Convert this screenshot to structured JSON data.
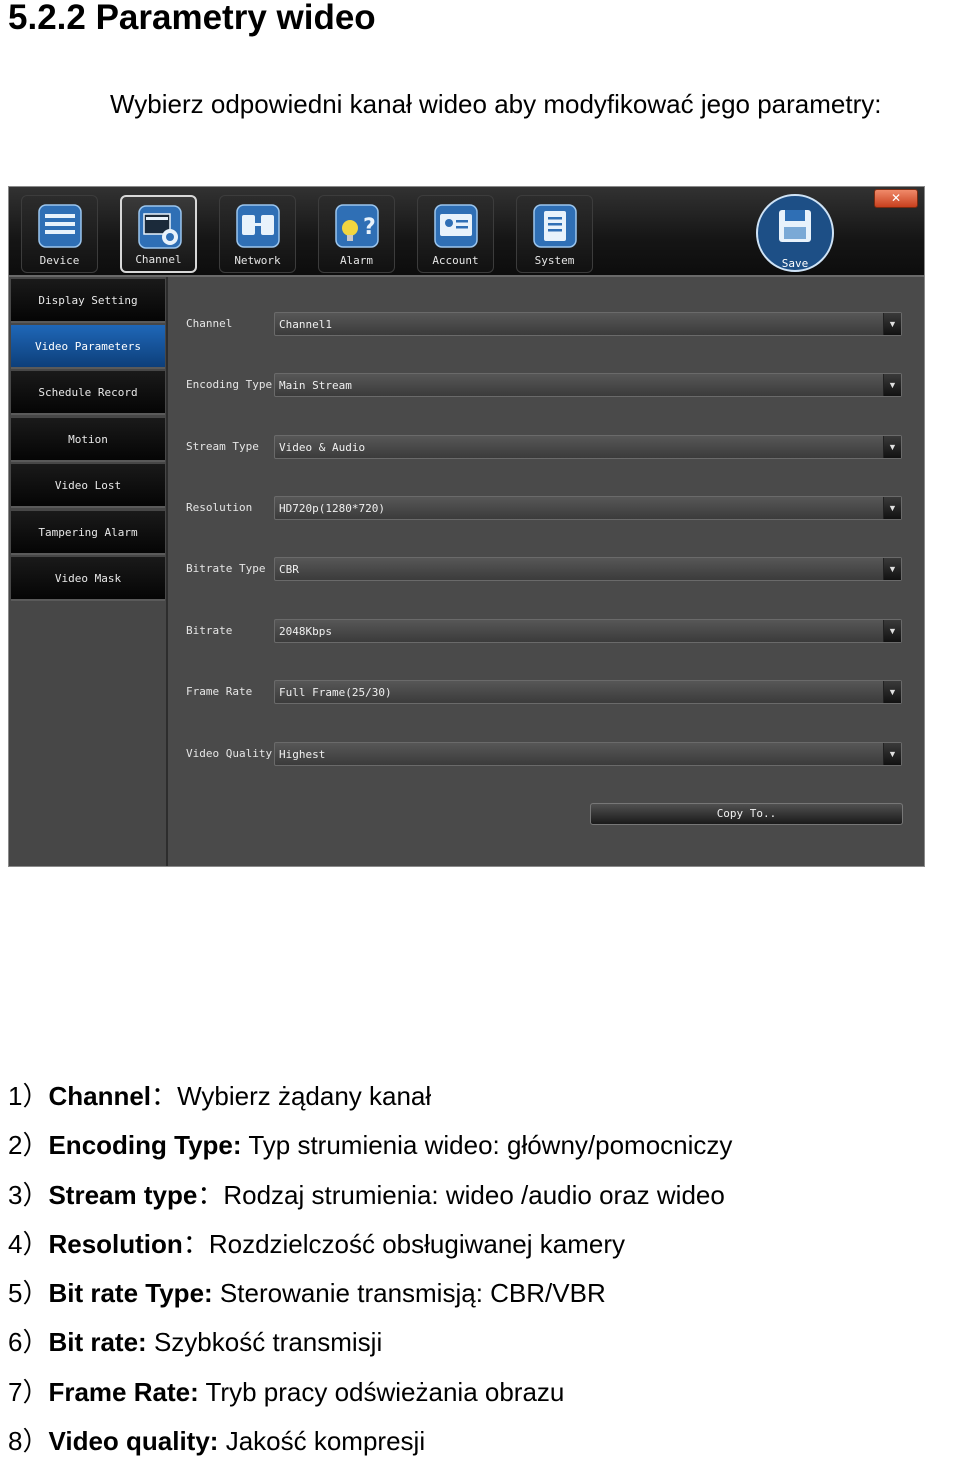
{
  "heading": "5.2.2 Parametry wideo",
  "intro": "Wybierz odpowiedni kanał wideo aby modyfikować jego parametry:",
  "window": {
    "close_glyph": "✕",
    "tabs": [
      {
        "label": "Device",
        "icon": "device-icon"
      },
      {
        "label": "Channel",
        "icon": "channel-icon"
      },
      {
        "label": "Network",
        "icon": "network-icon"
      },
      {
        "label": "Alarm",
        "icon": "alarm-icon"
      },
      {
        "label": "Account",
        "icon": "account-icon"
      },
      {
        "label": "System",
        "icon": "system-icon"
      }
    ],
    "active_tab": "Channel",
    "save_label": "Save",
    "sidebar": [
      "Display Setting",
      "Video Parameters",
      "Schedule Record",
      "Motion",
      "Video Lost",
      "Tampering Alarm",
      "Video Mask"
    ],
    "active_sidebar": "Video Parameters",
    "fields": [
      {
        "label": "Channel",
        "value": "Channel1"
      },
      {
        "label": "Encoding Type",
        "value": "Main Stream"
      },
      {
        "label": "Stream Type",
        "value": "Video & Audio"
      },
      {
        "label": "Resolution",
        "value": "HD720p(1280*720)"
      },
      {
        "label": "Bitrate Type",
        "value": "CBR"
      },
      {
        "label": "Bitrate",
        "value": "2048Kbps"
      },
      {
        "label": "Frame Rate",
        "value": "Full Frame(25/30)"
      },
      {
        "label": "Video Quality",
        "value": "Highest"
      }
    ],
    "copy_label": "Copy To..",
    "colors": {
      "highlight": "#1f67b8",
      "background": "#4a4a4a",
      "close": "#d9532f"
    }
  },
  "descriptions": [
    {
      "num": "1）",
      "term": "Channel",
      "sep": "：",
      "text": "Wybierz żądany kanał"
    },
    {
      "num": "2）",
      "term": "Encoding Type:",
      "sep": " ",
      "text": "Typ strumienia wideo: główny/pomocniczy"
    },
    {
      "num": "3）",
      "term": "Stream type",
      "sep": "：",
      "text": "Rodzaj strumienia: wideo /audio oraz wideo"
    },
    {
      "num": "4）",
      "term": "Resolution",
      "sep": "：",
      "text": "Rozdzielczość obsługiwanej kamery"
    },
    {
      "num": "5）",
      "term": "Bit rate Type:",
      "sep": " ",
      "text": "Sterowanie transmisją: CBR/VBR"
    },
    {
      "num": "6）",
      "term": "Bit rate:",
      "sep": " ",
      "text": "Szybkość transmisji"
    },
    {
      "num": "7）",
      "term": "Frame Rate:",
      "sep": " ",
      "text": "Tryb pracy odświeżania obrazu"
    },
    {
      "num": "8）",
      "term": "Video quality:",
      "sep": " ",
      "text": "Jakość kompresji"
    }
  ]
}
